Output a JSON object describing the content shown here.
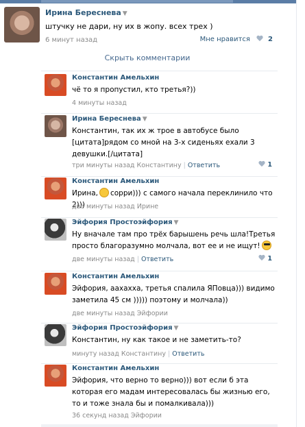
{
  "post": {
    "author": "Ирина Береснева",
    "text": "штучку не дари, ну их в жопу. всех трех )",
    "time": "6 минут назад",
    "like_label": "Мне нравится",
    "like_count": "2"
  },
  "hide_comments": "Скрыть комментарии",
  "comments": [
    {
      "author": "Константин Амельхин",
      "text": "чё то я пропустил, кто третья?))",
      "time": "4 минуты назад",
      "reply_to": "",
      "reply_label": "",
      "likes": ""
    },
    {
      "author": "Ирина Береснева",
      "text": "Константин, так их ж трое в автобусе было [цитата]рядом со мной на 3-х сиденьях ехали 3 девушки.[/цитата]",
      "time": "три минуты назад",
      "reply_to": "Константину",
      "reply_label": "Ответить",
      "likes": "1"
    },
    {
      "author": "Константин Амельхин",
      "text_before": "Ирина,",
      "text_after": "сорри))) с самого начала переклинило что 2)))",
      "time": "две минуты назад",
      "reply_to": "Ирине",
      "reply_label": "",
      "likes": ""
    },
    {
      "author": "Эйфория Простоэйфория",
      "text": "Ну вначале там про трёх барышень речь шла!Третья просто благоразумно молчала, вот ее и не ищут!",
      "time": "две минуты назад",
      "reply_to": "",
      "reply_label": "Ответить",
      "likes": "1"
    },
    {
      "author": "Константин Амельхин",
      "text": "Эйфория, аахахха, третья спалила ЯПовца))) видимо заметила 45 см ))))) поэтому и молчала))",
      "time": "две минуты назад",
      "reply_to": "Эйфории",
      "reply_label": "",
      "likes": ""
    },
    {
      "author": "Эйфория Простоэйфория",
      "text": "Константин, ну как такое и не заметить-то?",
      "time": "минуту назад",
      "reply_to": "Константину",
      "reply_label": "Ответить",
      "likes": ""
    },
    {
      "author": "Константин Амельхин",
      "text": "Эйфория, что верно то верно))) вот если б эта которая его мадам интересовалась бы жизнью его, то и тоже знала бы и помалкивала)))",
      "time": "36 секунд назад",
      "reply_to": "Эйфории",
      "reply_label": "",
      "likes": ""
    }
  ],
  "colors": {
    "link": "#2b587a",
    "meta": "#8a8a8a",
    "accent": "#5b7da6"
  },
  "icons": {
    "like": "heart-icon",
    "author_dropdown": "triangle-down-icon",
    "smile": "smile-emoji",
    "cool": "cool-emoji"
  }
}
